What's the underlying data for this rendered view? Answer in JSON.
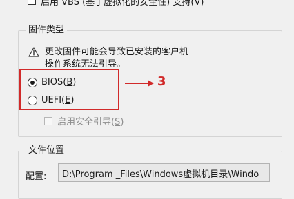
{
  "vbs": {
    "label": "启用 VBS (基于虚拟化的安全性) 支持(V)"
  },
  "firmware_group": {
    "title": "固件类型",
    "warning_line1": "更改固件可能会导致已安装的客户机",
    "warning_line2": "操作系统无法引导。",
    "bios_prefix": "BIOS(",
    "bios_key": "B",
    "bios_suffix": ")",
    "uefi_prefix": "UEFI(",
    "uefi_key": "E",
    "uefi_suffix": ")",
    "selected": "BIOS",
    "secure_boot_prefix": "启用安全引导(",
    "secure_boot_key": "S",
    "secure_boot_suffix": ")"
  },
  "annotation": {
    "number": "3",
    "color": "#d12a2a"
  },
  "file_group": {
    "title": "文件位置",
    "config_label_prefix": "配置(",
    "config_label_key": "",
    "config_label_text": "配置:",
    "config_path": "D:\\Program _Files\\Windows虚拟机目录\\Windo"
  }
}
